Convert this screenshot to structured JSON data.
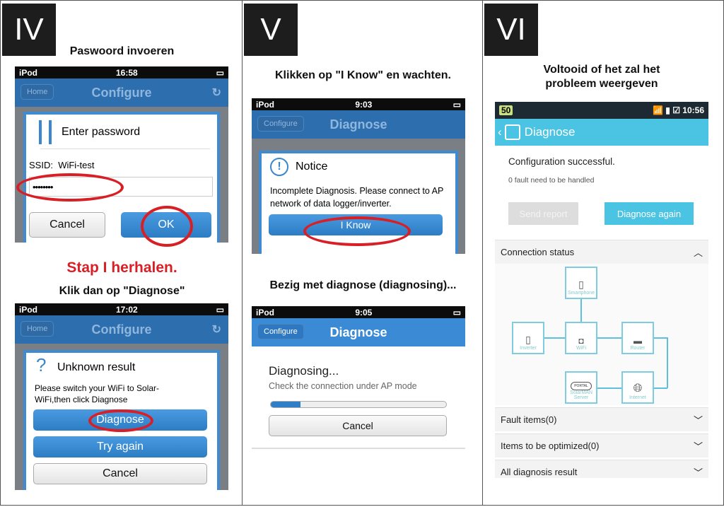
{
  "panels": [
    {
      "label": "IV",
      "title": "Paswoord invoeren",
      "phone1": {
        "carrier": "iPod",
        "time": "16:58",
        "nav_back": "Home",
        "nav_title": "Configure",
        "dialog_title": "Enter password",
        "ssid_label": "SSID:",
        "ssid_value": "WiFi-test",
        "password_value": "••••••••",
        "cancel": "Cancel",
        "ok": "OK"
      },
      "repeat_text": "Stap I herhalen.",
      "subtitle": "Klik dan op \"Diagnose\"",
      "phone2": {
        "carrier": "iPod",
        "time": "17:02",
        "nav_back": "Home",
        "nav_title": "Configure",
        "dialog_title": "Unknown result",
        "message": "Please switch your WiFi to Solar-WiFi,then click Diagnose",
        "diagnose": "Diagnose",
        "try_again": "Try again",
        "cancel": "Cancel"
      }
    },
    {
      "label": "V",
      "title": "Klikken op \"I Know\" en wachten.",
      "phone1": {
        "carrier": "iPod",
        "time": "9:03",
        "nav_back": "Configure",
        "nav_title": "Diagnose",
        "dialog_title": "Notice",
        "message": "Incomplete Diagnosis. Please connect to AP network of data logger/inverter.",
        "button": "I Know"
      },
      "subtitle": "Bezig met diagnose (diagnosing)...",
      "phone2": {
        "carrier": "iPod",
        "time": "9:05",
        "nav_back": "Configure",
        "nav_title": "Diagnose",
        "status": "Diagnosing...",
        "hint": "Check the connection under AP mode",
        "progress": 0.17,
        "cancel": "Cancel"
      }
    },
    {
      "label": "VI",
      "title": "Voltooid of het zal het probleem weergeven",
      "phone": {
        "badge": "50",
        "time": "10:56",
        "app_title": "Diagnose",
        "result": "Configuration successful.",
        "faults": "0 fault need to be handled",
        "send_report": "Send report",
        "diagnose_again": "Diagnose again",
        "connection_status": "Connection status",
        "nodes": {
          "smartphone": "Smartphone",
          "inverter": "Inverter",
          "wifi": "WiFi",
          "router": "Router",
          "server": "SolarMAN Server",
          "internet": "Internet",
          "portal": "PORTAL"
        },
        "sections": [
          "Fault items(0)",
          "Items to be optimized(0)",
          "All diagnosis result"
        ]
      }
    }
  ],
  "colors": {
    "accent_ios": "#2d7fc6",
    "accent_android": "#4bc3e3",
    "highlight": "#d81f26"
  }
}
